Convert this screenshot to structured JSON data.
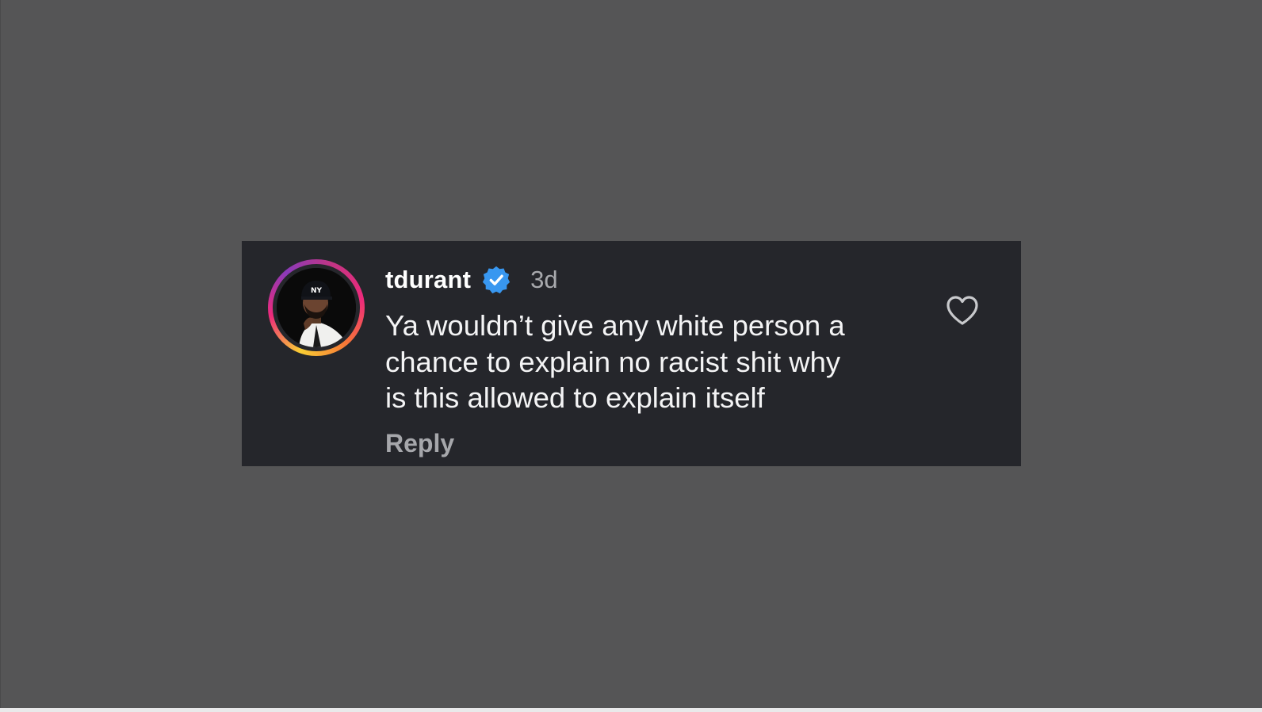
{
  "comment": {
    "username": "tdurant",
    "verified": true,
    "timestamp": "3d",
    "lines": [
      "Ya wouldn’t give any white person a",
      "chance to explain no racist shit why",
      "is this allowed to explain itself"
    ],
    "reply_label": "Reply",
    "like_icon": "heart-outline-icon",
    "verified_icon": "verified-badge-icon"
  },
  "colors": {
    "background": "#555556",
    "card": "#25262b",
    "verified_badge": "#3897f0",
    "text_primary": "#f4f4f5",
    "text_secondary": "#a6a7ab"
  }
}
